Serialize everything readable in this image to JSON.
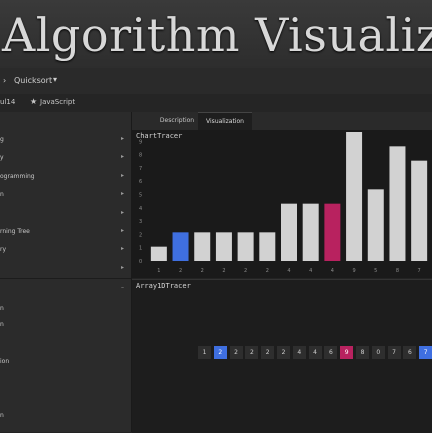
{
  "banner": {
    "title": "Algorithm Visualiz"
  },
  "nav": {
    "breadcrumb": "Quicksort"
  },
  "sub": {
    "left_text": "ul14",
    "language": "JavaScript"
  },
  "sidebar": {
    "items": [
      {
        "label": "g"
      },
      {
        "label": "y"
      },
      {
        "label": "ogramming"
      },
      {
        "label": "n"
      },
      {
        "label": ""
      },
      {
        "label": "rning Tree"
      },
      {
        "label": "ry"
      },
      {
        "label": ""
      }
    ],
    "plain_items": [
      "",
      "n",
      "n",
      "",
      "ion",
      "",
      "",
      "n"
    ]
  },
  "tabs": {
    "items": [
      {
        "label": "Description"
      },
      {
        "label": "Visualization"
      }
    ]
  },
  "colors": {
    "bar": "#d2d2d2",
    "compare": "#3f6fe0",
    "pivot": "#b8225f",
    "background": "#1a1a1a"
  },
  "chart_panel": {
    "title": "ChartTracer"
  },
  "array_panel": {
    "title": "Array1DTracer"
  },
  "chart_data": {
    "type": "bar",
    "title": "ChartTracer",
    "categories": [
      "1",
      "2",
      "2",
      "2",
      "2",
      "2",
      "4",
      "4",
      "4",
      "9",
      "5",
      "8",
      "7"
    ],
    "values": [
      1,
      2,
      2,
      2,
      2,
      2,
      4,
      4,
      4,
      9,
      5,
      8,
      7
    ],
    "highlight": {
      "compare": [
        1
      ],
      "pivot": [
        8
      ]
    },
    "ylim": [
      0,
      9
    ],
    "y_ticks": [
      "0",
      "1",
      "2",
      "3",
      "4",
      "5",
      "6",
      "7",
      "8",
      "9"
    ]
  },
  "array": {
    "values": [
      "1",
      "2",
      "2",
      "2",
      "2",
      "2",
      "4",
      "4",
      "6",
      "9",
      "8",
      "0",
      "7",
      "6",
      "7"
    ],
    "highlight": {
      "compare": [
        1,
        14
      ],
      "pivot": [
        9
      ]
    }
  }
}
